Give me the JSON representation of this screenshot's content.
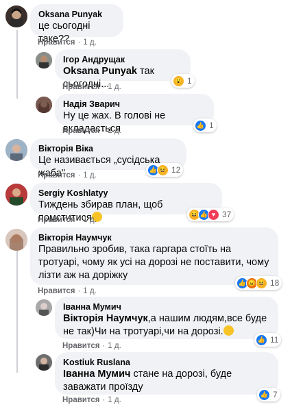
{
  "comments": [
    {
      "author": "Oksana Punyak",
      "text": "це сьогодні таке??",
      "like": "Нравится",
      "dot": "·",
      "time": "1 д."
    },
    {
      "author": "Ігор Андрущак",
      "mention": "Oksana Punyak",
      "text": " так сьогодні...",
      "like": "Нравится",
      "dot": "·",
      "time": "1 д.",
      "reactions": "1"
    },
    {
      "author": "Надія Зварич",
      "text": "Ну це жах. В голові не вкладається",
      "like": "Нравится",
      "dot": "·",
      "time": "1 д.",
      "reactions": "1"
    },
    {
      "author": "Вікторія Віка",
      "text": "Це називається „сусідська жаба\"",
      "like": "Нравится",
      "dot": "·",
      "time": "1 д.",
      "reactions": "12"
    },
    {
      "author": "Sergiy Koshlatyy",
      "text": "Тиждень збирав план, щоб помститися",
      "like": "Нравится",
      "dot": "·",
      "time": "1 д.",
      "reactions": "37"
    },
    {
      "author": "Вікторія Наумчук",
      "text": "Правильно зробив, така гаргара стоїть на тротуарі, чому як усі на дорозі не поставити, чому лізти аж на доріжку",
      "like": "Нравится",
      "dot": "·",
      "time": "1 д.",
      "reactions": "18"
    },
    {
      "author": "Іванна Мумич",
      "mention": "Вікторія Наумчук",
      "text": ",а нашим людям,все буде не так)Чи на тротуарі,чи на дорозі.",
      "like": "Нравится",
      "dot": "·",
      "time": "1 д.",
      "reactions": "11"
    },
    {
      "author": "Kostiuk Ruslana",
      "mention": "Іванна Мумич",
      "text": " стане на дорозі, буде заважати проїзду",
      "like": "Нравится",
      "dot": "·",
      "time": "1 д.",
      "reactions": "7"
    }
  ],
  "colors": {
    "bubble": "#f0f2f5",
    "meta": "#65676b",
    "like_blue": "#1877f2"
  }
}
